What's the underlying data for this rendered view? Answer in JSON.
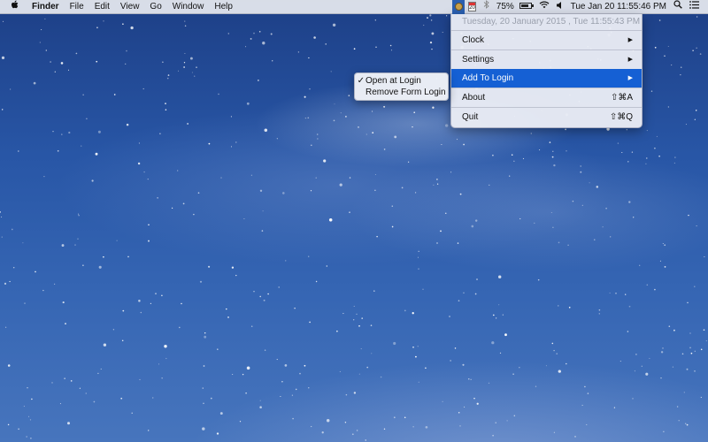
{
  "menubar": {
    "app_name": "Finder",
    "menus": [
      "File",
      "Edit",
      "View",
      "Go",
      "Window",
      "Help"
    ],
    "calendar_day": "20",
    "battery_percent": "75%",
    "battery_level": 0.75,
    "datetime": "Tue Jan 20  11:55:46 PM"
  },
  "dropdown": {
    "header": "Tuesday, 20 January 2015 , Tue 11:55:43 PM",
    "items": [
      {
        "label": "Clock",
        "type": "submenu"
      },
      {
        "label": "Settings",
        "type": "submenu"
      },
      {
        "label": "Add To Login",
        "type": "submenu",
        "highlighted": true
      },
      {
        "label": "About",
        "shortcut": "⇧⌘A"
      },
      {
        "label": "Quit",
        "shortcut": "⇧⌘Q"
      }
    ],
    "highlight_color": "#1560d4"
  },
  "submenu": {
    "items": [
      {
        "label": "Open at Login",
        "checked": true
      },
      {
        "label": "Remove Form Login",
        "checked": false
      }
    ]
  },
  "icons": {
    "apple": "apple-logo-icon",
    "status_clock": "clock-app-icon",
    "calendar": "calendar-icon",
    "bluetooth": "bluetooth-icon",
    "battery": "battery-icon",
    "wifi": "wifi-icon",
    "volume": "volume-icon",
    "spotlight": "search-icon",
    "notification_center": "list-icon"
  }
}
